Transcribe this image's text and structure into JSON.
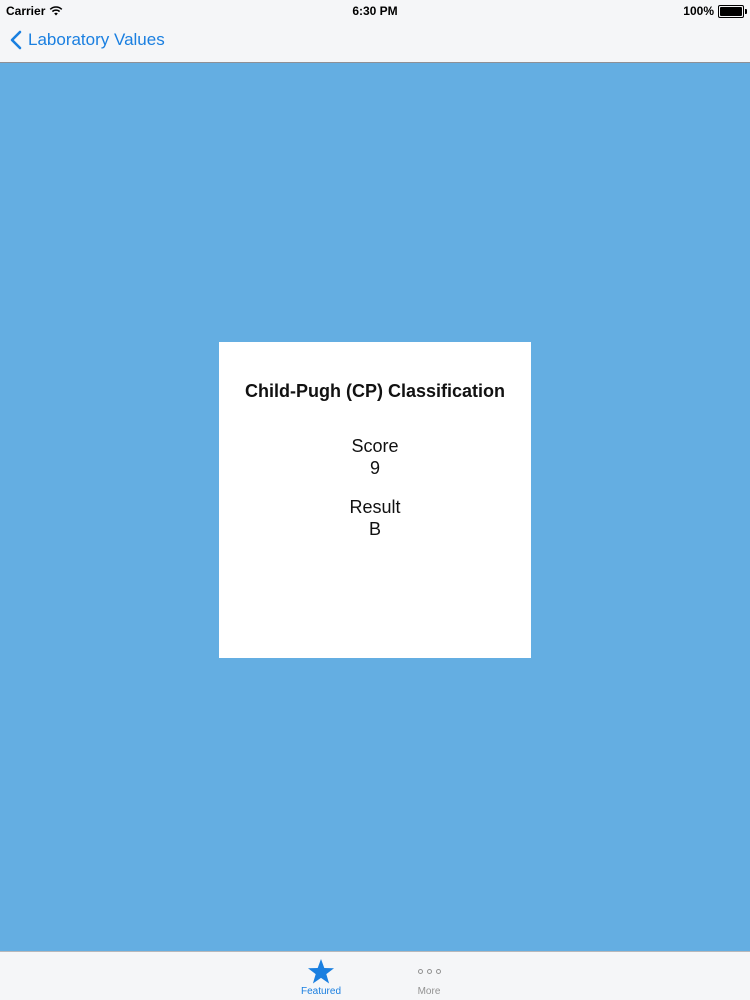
{
  "status_bar": {
    "carrier": "Carrier",
    "time": "6:30 PM",
    "battery": "100%"
  },
  "nav": {
    "back_label": "Laboratory Values"
  },
  "card": {
    "title": "Child-Pugh (CP) Classification",
    "score_label": "Score",
    "score_value": "9",
    "result_label": "Result",
    "result_value": "B"
  },
  "tab_bar": {
    "tabs": [
      {
        "label": "Featured",
        "icon": "star-icon",
        "selected": true
      },
      {
        "label": "More",
        "icon": "more-dots-icon",
        "selected": false
      }
    ]
  },
  "colors": {
    "background": "#64aee2",
    "accent": "#1a7fe0"
  }
}
